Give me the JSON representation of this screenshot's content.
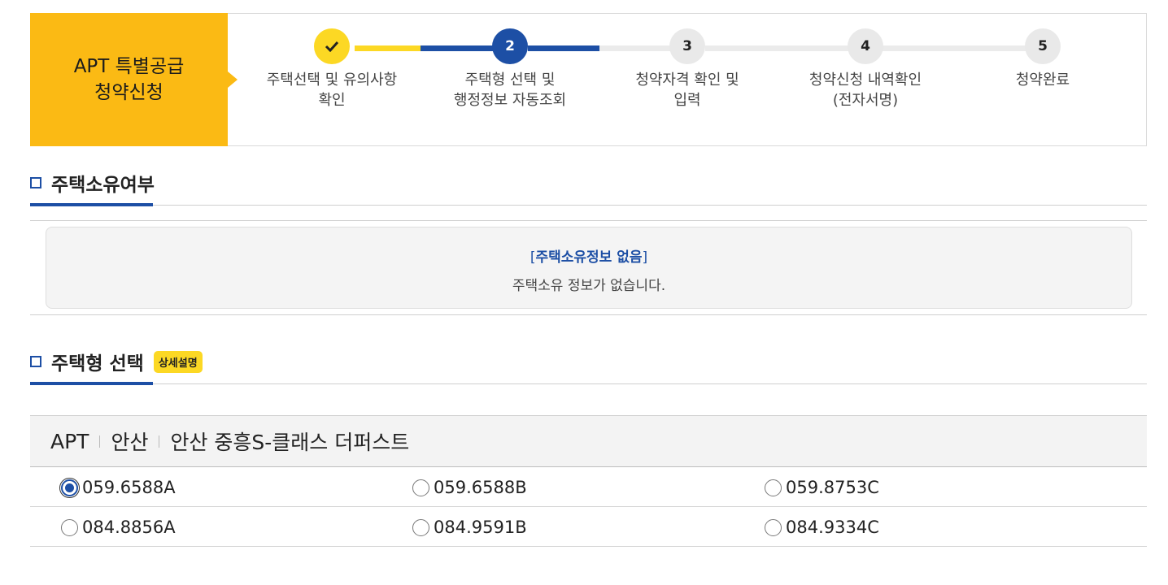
{
  "header": {
    "title_line1": "APT 특별공급",
    "title_line2": "청약신청"
  },
  "steps": [
    {
      "number": "✓",
      "label_line1": "주택선택 및 유의사항",
      "label_line2": "확인",
      "state": "done"
    },
    {
      "number": "2",
      "label_line1": "주택형 선택 및",
      "label_line2": "행정정보 자동조회",
      "state": "active"
    },
    {
      "number": "3",
      "label_line1": "청약자격 확인 및",
      "label_line2": "입력",
      "state": "pending"
    },
    {
      "number": "4",
      "label_line1": "청약신청 내역확인",
      "label_line2": "(전자서명)",
      "state": "pending"
    },
    {
      "number": "5",
      "label_line1": "청약완료",
      "label_line2": "",
      "state": "pending"
    }
  ],
  "ownership": {
    "section_title": "주택소유여부",
    "info_open": "[",
    "info_title": "주택소유정보 없음",
    "info_close": "]",
    "info_text": "주택소유 정보가 없습니다."
  },
  "housing_type": {
    "section_title": "주택형 선택",
    "detail_badge": "상세설명",
    "breadcrumb": [
      "APT",
      "안산",
      "안산 중흥S-클래스 더퍼스트"
    ],
    "options": [
      "059.6588A",
      "059.6588B",
      "059.8753C",
      "084.8856A",
      "084.9591B",
      "084.9334C"
    ],
    "selected": "059.6588A"
  },
  "colors": {
    "accent_yellow": "#fbba14",
    "check_yellow": "#fcd824",
    "primary_blue": "#1d4fa5"
  }
}
